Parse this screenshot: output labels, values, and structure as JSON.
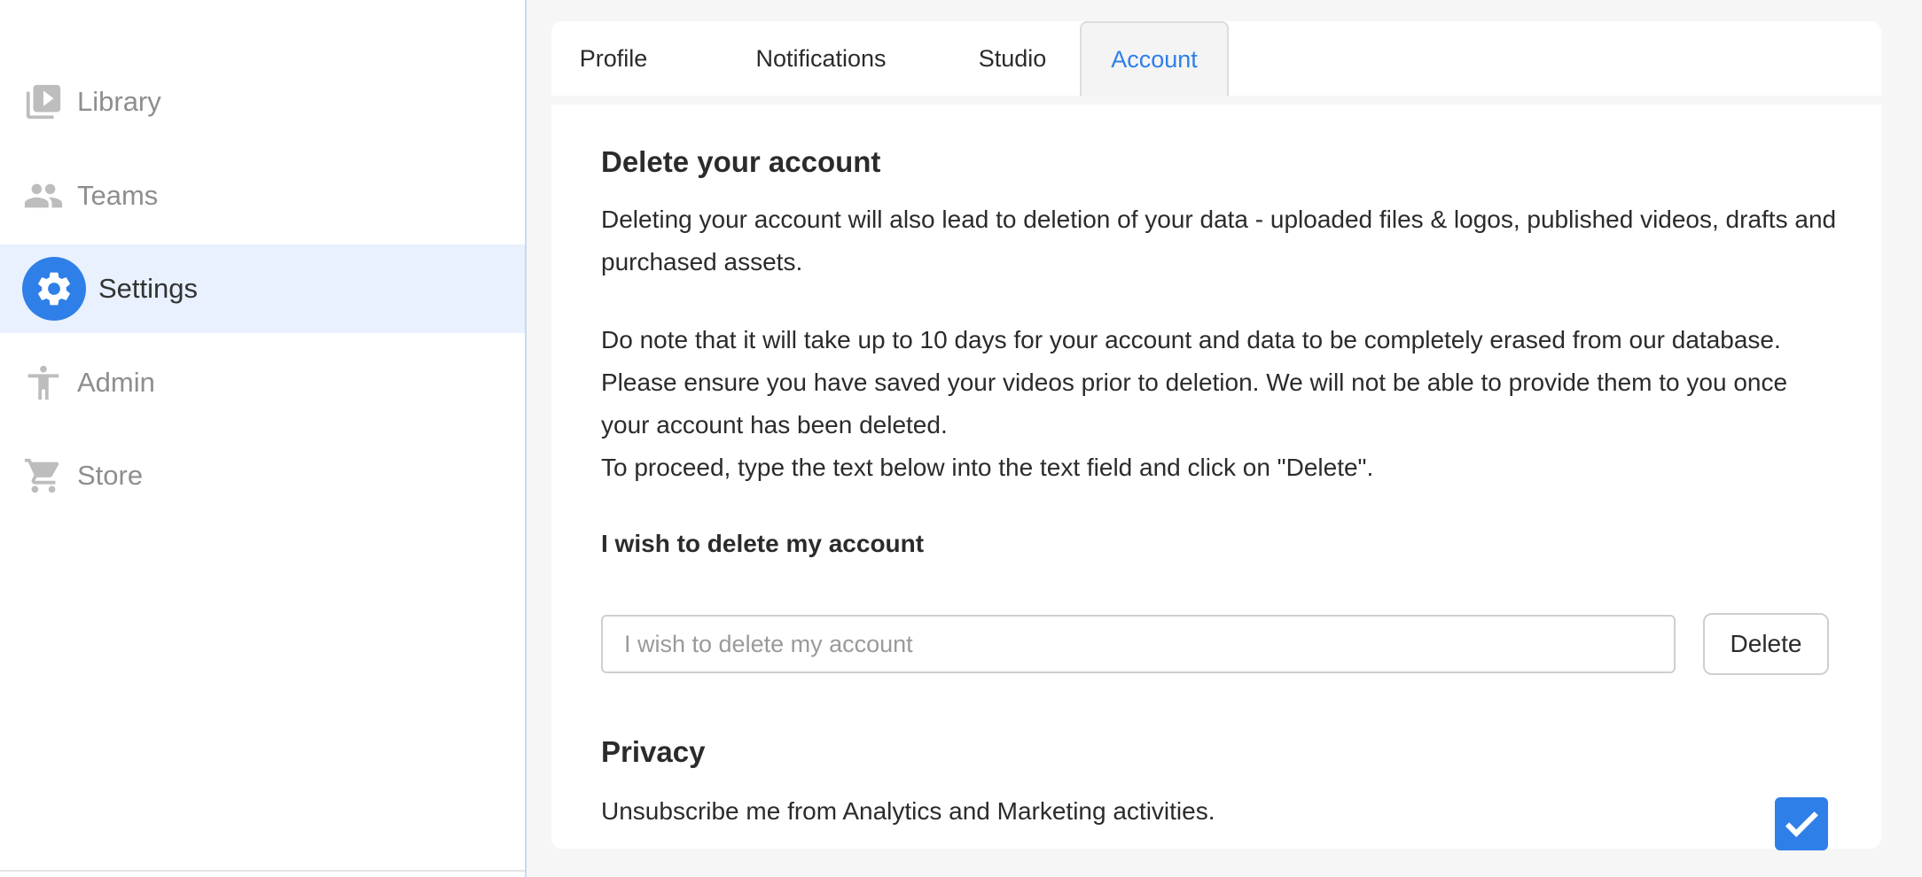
{
  "sidebar": {
    "items": [
      {
        "label": "Library",
        "icon": "library-icon",
        "active": false
      },
      {
        "label": "Teams",
        "icon": "people-icon",
        "active": false
      },
      {
        "label": "Settings",
        "icon": "gear-icon",
        "active": true
      },
      {
        "label": "Admin",
        "icon": "accessibility-icon",
        "active": false
      },
      {
        "label": "Store",
        "icon": "cart-icon",
        "active": false
      }
    ]
  },
  "tabs": [
    {
      "label": "Profile",
      "active": false
    },
    {
      "label": "Notifications",
      "active": false
    },
    {
      "label": "Studio",
      "active": false
    },
    {
      "label": "Account",
      "active": true
    }
  ],
  "account": {
    "delete_heading": "Delete your account",
    "paragraph1": "Deleting your account will also lead to deletion of your data - uploaded files & logos, published videos, drafts and purchased assets.",
    "paragraph2": "Do note that it will take up to 10 days for your account and data to be completely erased from our database. Please ensure you have saved your videos prior to deletion. We will not be able to provide them to you once your account has been deleted.",
    "paragraph3": "To proceed, type the text below into the text field and click on \"Delete\".",
    "confirm_text": "I wish to delete my account",
    "input_placeholder": "I wish to delete my account",
    "input_value": "",
    "delete_button": "Delete"
  },
  "privacy": {
    "heading": "Privacy",
    "unsubscribe_label": "Unsubscribe me from Analytics and Marketing activities.",
    "unsubscribe_checked": true
  },
  "colors": {
    "accent": "#2f7fe8",
    "active_nav_bg": "#e8f1fd"
  }
}
